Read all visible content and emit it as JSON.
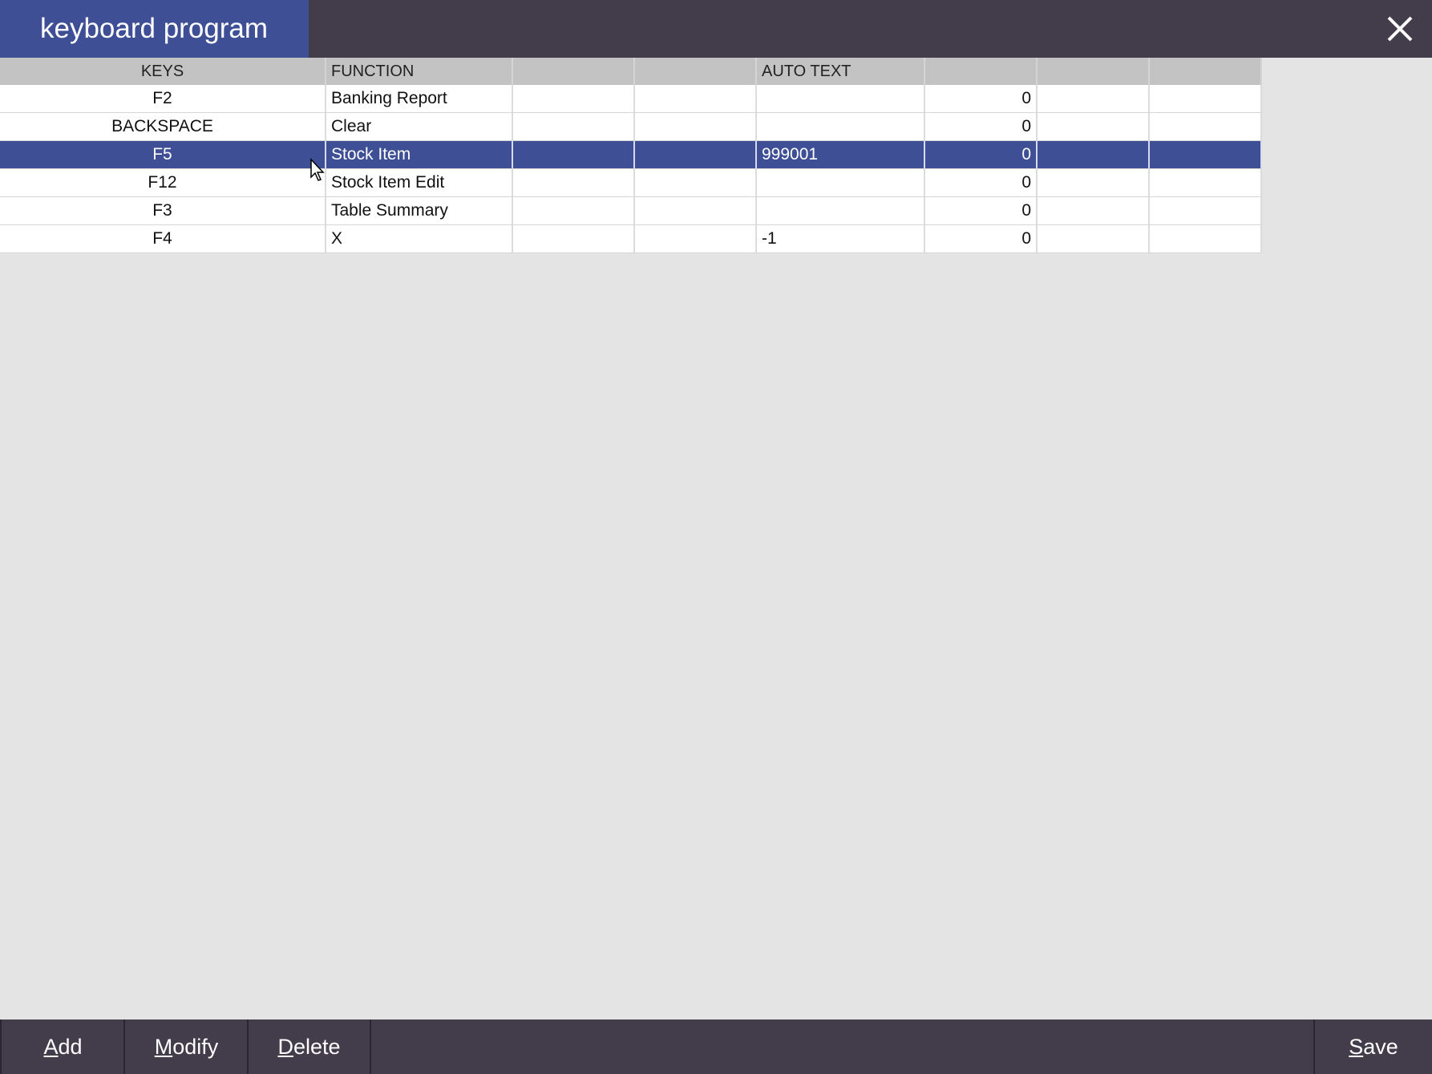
{
  "window": {
    "title": "keyboard program",
    "close_icon": "close-icon"
  },
  "table": {
    "columns": [
      "KEYS",
      "FUNCTION",
      "",
      "",
      "AUTO TEXT",
      "",
      "",
      ""
    ],
    "rows": [
      {
        "key": "F2",
        "function": "Banking Report",
        "c2": "",
        "c3": "",
        "auto_text": "",
        "num": "0",
        "c6": "",
        "c7": "",
        "selected": false
      },
      {
        "key": "BACKSPACE",
        "function": "Clear",
        "c2": "",
        "c3": "",
        "auto_text": "",
        "num": "0",
        "c6": "",
        "c7": "",
        "selected": false
      },
      {
        "key": "F5",
        "function": "Stock Item",
        "c2": "",
        "c3": "",
        "auto_text": "999001",
        "num": "0",
        "c6": "",
        "c7": "",
        "selected": true
      },
      {
        "key": "F12",
        "function": "Stock Item Edit",
        "c2": "",
        "c3": "",
        "auto_text": "",
        "num": "0",
        "c6": "",
        "c7": "",
        "selected": false
      },
      {
        "key": "F3",
        "function": "Table Summary",
        "c2": "",
        "c3": "",
        "auto_text": "",
        "num": "0",
        "c6": "",
        "c7": "",
        "selected": false
      },
      {
        "key": "F4",
        "function": "X",
        "c2": "",
        "c3": "",
        "auto_text": "-1",
        "num": "0",
        "c6": "",
        "c7": "",
        "selected": false
      }
    ]
  },
  "footer": {
    "add": {
      "mnemonic": "A",
      "rest": "dd"
    },
    "modify": {
      "mnemonic": "M",
      "rest": "odify"
    },
    "delete": {
      "mnemonic": "D",
      "rest": "elete"
    },
    "save": {
      "mnemonic": "S",
      "rest": "ave"
    }
  },
  "colors": {
    "titlebar": "#433c4b",
    "accent": "#3e4f96",
    "background": "#e4e4e4",
    "header": "#c3c3c3"
  }
}
